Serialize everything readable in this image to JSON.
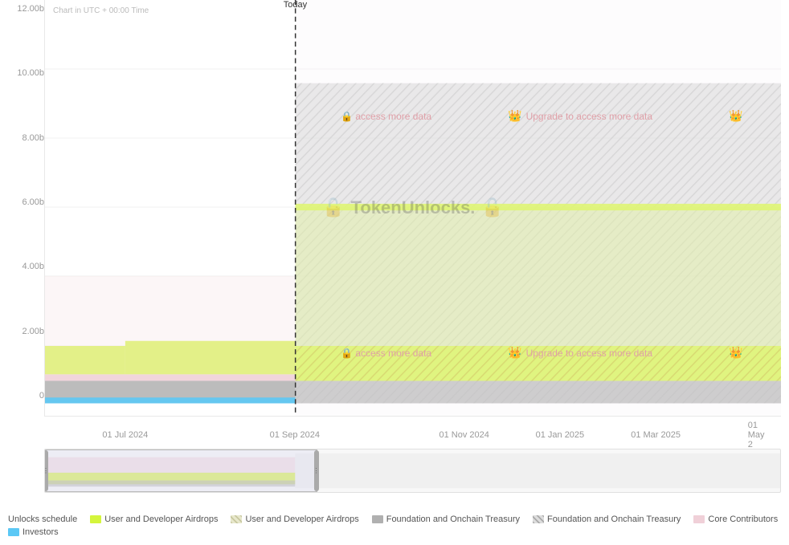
{
  "chart": {
    "utc_label": "Chart in UTC + 00:00 Time",
    "today_label": "Today",
    "y_axis": {
      "labels": [
        "12.00b",
        "10.00b",
        "8.00b",
        "6.00b",
        "4.00b",
        "2.00b",
        "0"
      ]
    },
    "x_axis": {
      "labels": [
        {
          "text": "01 Jul 2024",
          "pct": 11
        },
        {
          "text": "01 Sep 2024",
          "pct": 34
        },
        {
          "text": "01 Nov 2024",
          "pct": 57
        },
        {
          "text": "01 Jan 2025",
          "pct": 70
        },
        {
          "text": "01 Mar 2025",
          "pct": 83
        },
        {
          "text": "01 May 2",
          "pct": 97
        }
      ]
    },
    "today_pct": 34,
    "upgrade_messages": [
      {
        "text": "access more data",
        "show_crown": false
      },
      {
        "text": "Upgrade to access more data",
        "show_crown": true
      },
      {
        "text": "",
        "show_crown": true
      }
    ]
  },
  "legend": {
    "title": "Unlocks schedule",
    "items": [
      {
        "label": "User and Developer Airdrops",
        "type": "solid",
        "color": "#d4f53c"
      },
      {
        "label": "User and Developer Airdrops",
        "type": "hatched-yellow",
        "color": "#e8e8cc"
      },
      {
        "label": "Foundation and Onchain Treasury",
        "type": "solid",
        "color": "#b0b0b0"
      },
      {
        "label": "Foundation and Onchain Treasury",
        "type": "hatched-gray",
        "color": "#ddd"
      },
      {
        "label": "Core Contributors",
        "type": "solid",
        "color": "#f0d0d8"
      },
      {
        "label": "Investors",
        "type": "solid",
        "color": "#5bc8f5"
      }
    ]
  }
}
